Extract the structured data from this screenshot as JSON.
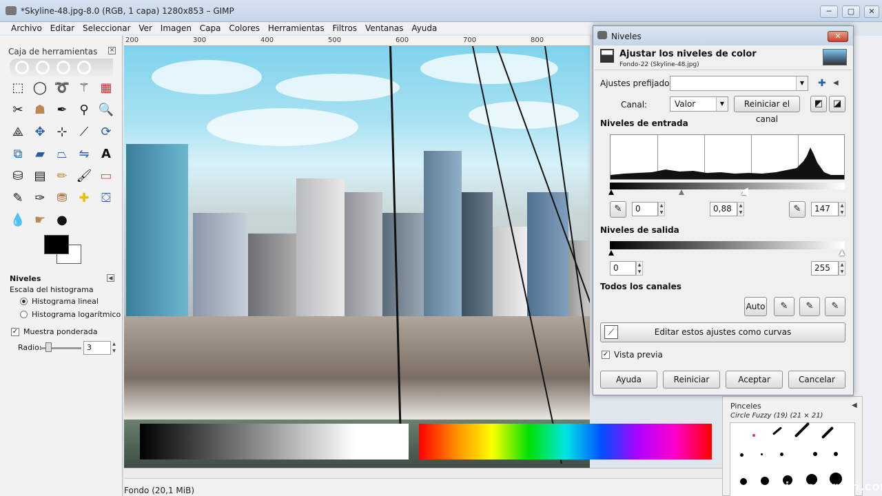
{
  "window": {
    "title": "*Skyline-48.jpg-8.0 (RGB, 1 capa) 1280x853 – GIMP",
    "minimize": "─",
    "maximize": "▢",
    "close": "✕"
  },
  "menu": [
    "Archivo",
    "Editar",
    "Seleccionar",
    "Ver",
    "Imagen",
    "Capa",
    "Colores",
    "Herramientas",
    "Filtros",
    "Ventanas",
    "Ayuda"
  ],
  "toolbox": {
    "title": "Caja de herramientas",
    "tool_options_title": "Niveles",
    "histogram_scale_label": "Escala del histograma",
    "linear_label": "Histograma lineal",
    "log_label": "Histograma logarítmico",
    "sample_merged_label": "Muestra ponderada",
    "radius_label": "Radio:",
    "radius_value": "3"
  },
  "ruler": [
    "200",
    "300",
    "400",
    "500",
    "600",
    "700",
    "800"
  ],
  "status": "Fondo (20,1 MiB)",
  "dock": {
    "title": "Pinceles",
    "brush": "Circle Fuzzy (19) (21 × 21)"
  },
  "watermark": "video2brain.com",
  "dialog": {
    "window_title": "Niveles",
    "heading": "Ajustar los niveles de color",
    "subheading": "Fondo-22 (Skyline-48.jpg)",
    "presets_label": "Ajustes prefijados:",
    "presets_value": "",
    "channel_label": "Canal:",
    "channel_value": "Valor",
    "reset_channel": "Reiniciar el canal",
    "input_levels": "Niveles de entrada",
    "input_low": "0",
    "input_gamma": "0,88",
    "input_high": "147",
    "output_levels": "Niveles de salida",
    "output_low": "0",
    "output_high": "255",
    "all_channels": "Todos los canales",
    "auto": "Auto",
    "edit_as_curves": "Editar estos ajustes como curvas",
    "preview_label": "Vista previa",
    "help": "Ayuda",
    "reset": "Reiniciar",
    "ok": "Aceptar",
    "cancel": "Cancelar"
  }
}
